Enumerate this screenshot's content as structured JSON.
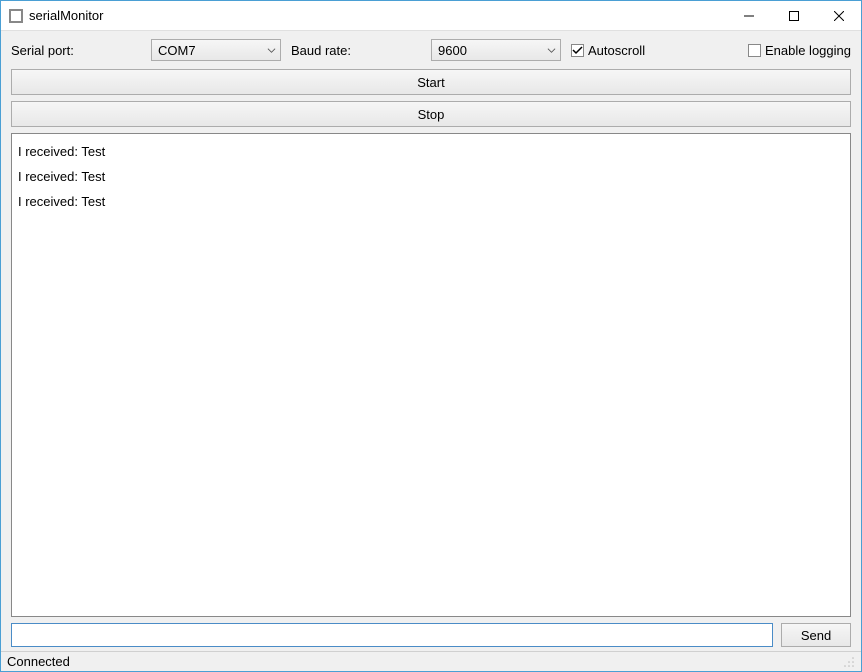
{
  "window": {
    "title": "serialMonitor"
  },
  "config": {
    "serial_port_label": "Serial port:",
    "serial_port_value": "COM7",
    "baud_rate_label": "Baud rate:",
    "baud_rate_value": "9600",
    "autoscroll_label": "Autoscroll",
    "autoscroll_checked": true,
    "enable_logging_label": "Enable logging",
    "enable_logging_checked": false
  },
  "buttons": {
    "start_label": "Start",
    "stop_label": "Stop",
    "send_label": "Send"
  },
  "output_lines": [
    "I received: Test",
    "I received: Test",
    "I received: Test"
  ],
  "send_input_value": "",
  "status": {
    "text": "Connected"
  }
}
